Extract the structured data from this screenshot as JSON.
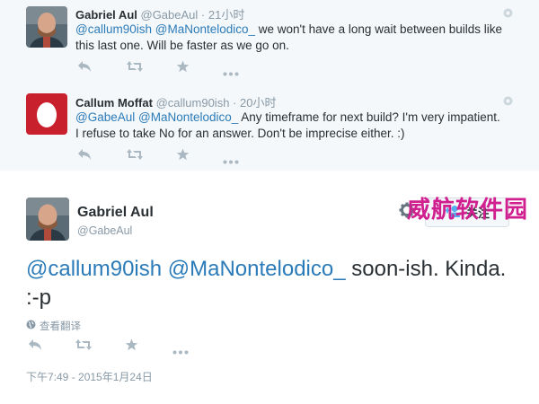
{
  "colors": {
    "link": "#2b7bb9",
    "muted": "#8899a6",
    "text": "#292f33",
    "watermark": "#d02090"
  },
  "tweets": [
    {
      "name": "Gabriel Aul",
      "handle": "@GabeAul",
      "dot": "·",
      "time": "21小时",
      "mention1": "@callum90ish",
      "mention2": "@MaNontelodico_",
      "text": " we won't have a long wait between builds like this last one. Will be faster as we go on."
    },
    {
      "name": "Callum Moffat",
      "handle": "@callum90ish",
      "dot": "·",
      "time": "20小时",
      "mention1": "@GabeAul",
      "mention2": "@MaNontelodico_",
      "text": "  Any timeframe for next build? I'm very impatient. I refuse to take No for an answer. Don't be imprecise either. :)"
    }
  ],
  "main_tweet": {
    "name": "Gabriel Aul",
    "handle": "@GabeAul",
    "follow_label": "关注",
    "mention1": "@callum90ish",
    "mention2": "@MaNontelodico_",
    "text": " soon-ish. Kinda. :-p",
    "translate_label": "查看翻译",
    "timestamp": "下午7:49 - 2015年1月24日"
  },
  "watermark": "威航软件园"
}
